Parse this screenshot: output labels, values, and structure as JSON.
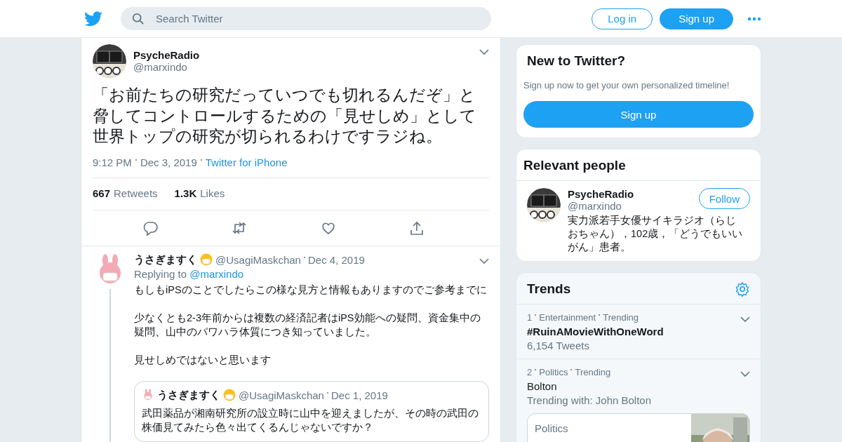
{
  "header": {
    "search": {
      "placeholder": "Search Twitter"
    },
    "buttons": [
      {
        "label": "Log in",
        "kind": "outline"
      },
      {
        "label": "Sign up",
        "kind": "filled"
      }
    ]
  },
  "tweet": {
    "name": "PsycheRadio",
    "handle": "@marxindo",
    "text": "「お前たちの研究だっていつでも切れるんだぞ」と脅してコントロールするための「見せしめ」として世界トップの研究が切られるわけですラジね。",
    "time": "9:12 PM",
    "date": "Dec 3, 2019",
    "source": "Twitter for iPhone",
    "stats": [
      {
        "count": "667",
        "label": "Retweets"
      },
      {
        "count": "1.3K",
        "label": "Likes"
      }
    ]
  },
  "reply": {
    "name": "うさぎますく",
    "handle": "@UsagiMaskchan",
    "date": "Dec 4, 2019",
    "replying_label": "Replying to",
    "replying_to": "@marxindo",
    "paragraphs": [
      "もしもiPSのことでしたらこの様な見方と情報もありますのでご参考までに",
      "少なくとも2-3年前からは複数の経済記者はiPS効能への疑問、資金集中の疑問、山中のパワハラ体質につき知っていました。",
      "見せしめではないと思います"
    ],
    "quote": {
      "name": "うさぎますく",
      "handle": "@UsagiMaskchan",
      "date": "Dec 1, 2019",
      "text": "武田薬品が湘南研究所の設立時に山中を迎えましたが、その時の武田の株価見てみたら色々出てくるんじゃないですか？"
    }
  },
  "signup_card": {
    "title": "New to Twitter?",
    "text": "Sign up now to get your own personalized timeline!",
    "button": "Sign up"
  },
  "relevant": {
    "title": "Relevant people",
    "people": [
      {
        "name": "PsycheRadio",
        "handle": "@marxindo",
        "bio": "実力派若手女優サイキラジオ（らじおちゃん），102歳，「どうでもいいがん」患者。",
        "button": "Follow"
      }
    ]
  },
  "trends": {
    "title": "Trends",
    "items": [
      {
        "rank": "1",
        "category": "Entertainment",
        "status": "Trending",
        "name": "#RuinAMovieWithOneWord",
        "detail": "6,154 Tweets"
      },
      {
        "rank": "2",
        "category": "Politics",
        "status": "Trending",
        "name": "Bolton",
        "detail": "Trending with: John Bolton",
        "card": {
          "label": "Politics"
        }
      }
    ]
  }
}
